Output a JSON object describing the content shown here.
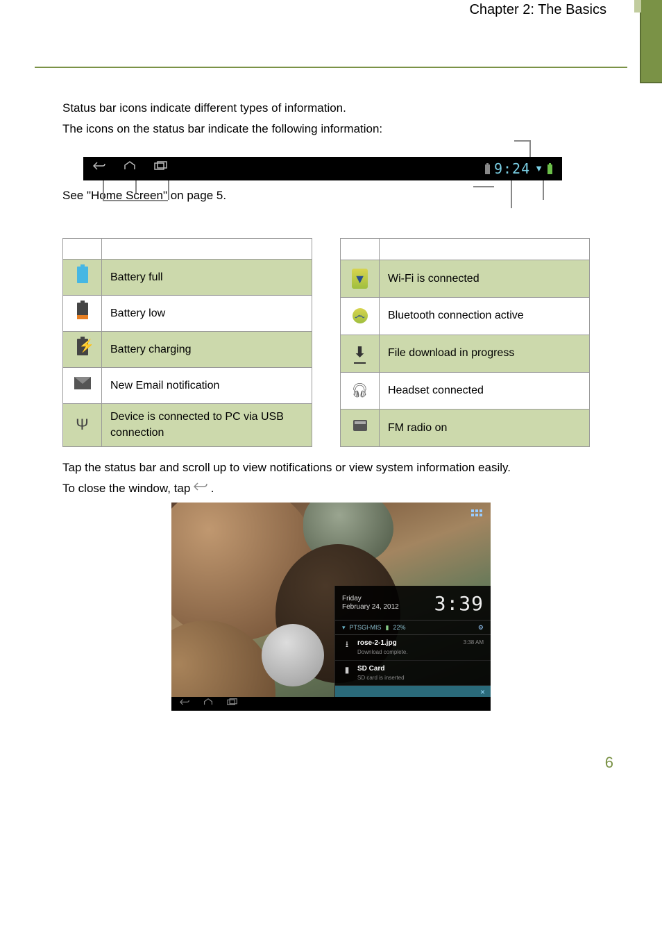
{
  "header": {
    "chapter": "Chapter 2: The Basics"
  },
  "intro": {
    "line1": "Status bar icons indicate different types of information.",
    "line2": "The icons on the status bar indicate the following information:"
  },
  "statusbar": {
    "time": "9:24"
  },
  "ref": "See \"Home Screen\" on page 5.",
  "left_table": [
    "Battery full",
    "Battery low",
    "Battery charging",
    "New Email notification",
    "Device is connected to PC via USB connection"
  ],
  "right_table": [
    "Wi-Fi is connected",
    "Bluetooth connection active",
    "File download in progress",
    "Headset connected",
    "FM radio on"
  ],
  "closing": {
    "line1": "Tap the status bar and scroll up to view notifications or view system information easily.",
    "line2a": "To close the window, tap ",
    "line2b": "."
  },
  "panel": {
    "day": "Friday",
    "date": "February 24, 2012",
    "time": "3:39",
    "ssid": "PTSGI-MIS",
    "batt": "22%",
    "notif1_title": "rose-2-1.jpg",
    "notif1_sub": "Download complete.",
    "notif1_time": "3:38 AM",
    "notif2_title": "SD Card",
    "notif2_sub": "SD card is inserted"
  },
  "page_number": "6"
}
